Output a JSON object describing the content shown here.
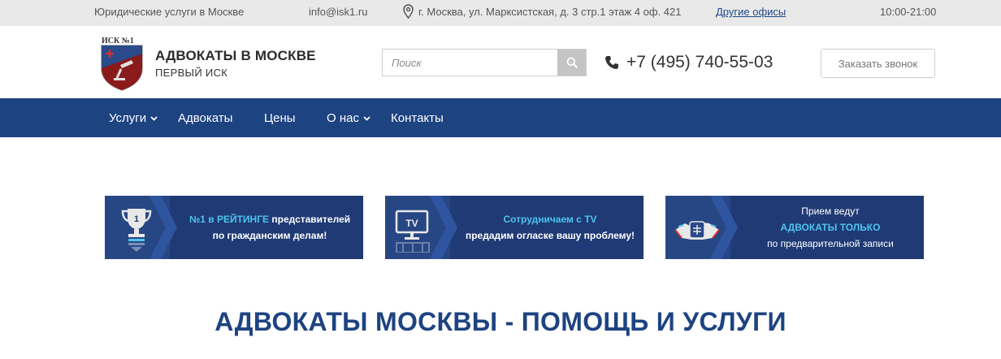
{
  "topbar": {
    "tagline": "Юридические услуги в Москве",
    "email": "info@isk1.ru",
    "address": "г. Москва, ул. Марксистская, д. 3 стр.1 этаж 4 оф. 421",
    "other_offices": "Другие офисы",
    "hours": "10:00-21:00"
  },
  "brand": {
    "logo_text": "ИСК №1",
    "title": "АДВОКАТЫ В МОСКВЕ",
    "subtitle": "ПЕРВЫЙ ИСК"
  },
  "search": {
    "placeholder": "Поиск",
    "value": ""
  },
  "phone": "+7 (495) 740-55-03",
  "callback_label": "Заказать звонок",
  "nav": [
    {
      "label": "Услуги",
      "has_dropdown": true
    },
    {
      "label": "Адвокаты",
      "has_dropdown": false
    },
    {
      "label": "Цены",
      "has_dropdown": false
    },
    {
      "label": "О нас",
      "has_dropdown": true
    },
    {
      "label": "Контакты",
      "has_dropdown": false
    }
  ],
  "banners": [
    {
      "icon": "trophy-icon",
      "trophy_number": "1",
      "line1_a": "№1 в ",
      "line1_hl": "РЕЙТИНГЕ",
      "line1_b": " представителей",
      "line2": "по гражданским делам!"
    },
    {
      "icon": "tv-icon",
      "tv_label": "TV",
      "line1": "Сотрудничаем с TV",
      "line2": "предадим огласке вашу проблему!"
    },
    {
      "icon": "handshake-icon",
      "line1": "Прием ведут",
      "line2": "АДВОКАТЫ ТОЛЬКО",
      "line3": "по предварительной записи"
    }
  ],
  "main_title": "АДВОКАТЫ МОСКВЫ - ПОМОЩЬ И УСЛУГИ",
  "colors": {
    "nav_bg": "#1d4381",
    "banner_bg": "#1f3a74",
    "highlight": "#4ec3ee",
    "topbar_bg": "#e9e9e9"
  }
}
